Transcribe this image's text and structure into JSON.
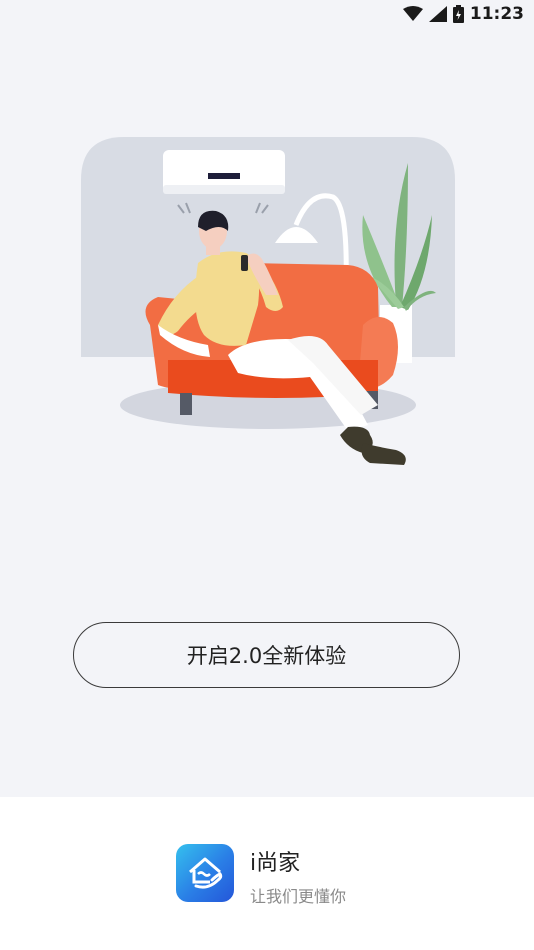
{
  "status_bar": {
    "time": "11:23",
    "icons": [
      "wifi-icon",
      "cellular-signal-icon",
      "battery-icon"
    ]
  },
  "illustration": {
    "description_icon": "man-relaxing-on-sofa-illustration"
  },
  "cta": {
    "label": "开启2.0全新体验"
  },
  "footer": {
    "app_name": "i尚家",
    "slogan": "让我们更懂你",
    "logo_icon": "house-hand-logo-icon"
  },
  "colors": {
    "background": "#f3f4f8",
    "footer_bg": "#ffffff",
    "sofa": "#f05a2c",
    "logo_gradient_start": "#35c0ee",
    "logo_gradient_end": "#2456d9"
  }
}
